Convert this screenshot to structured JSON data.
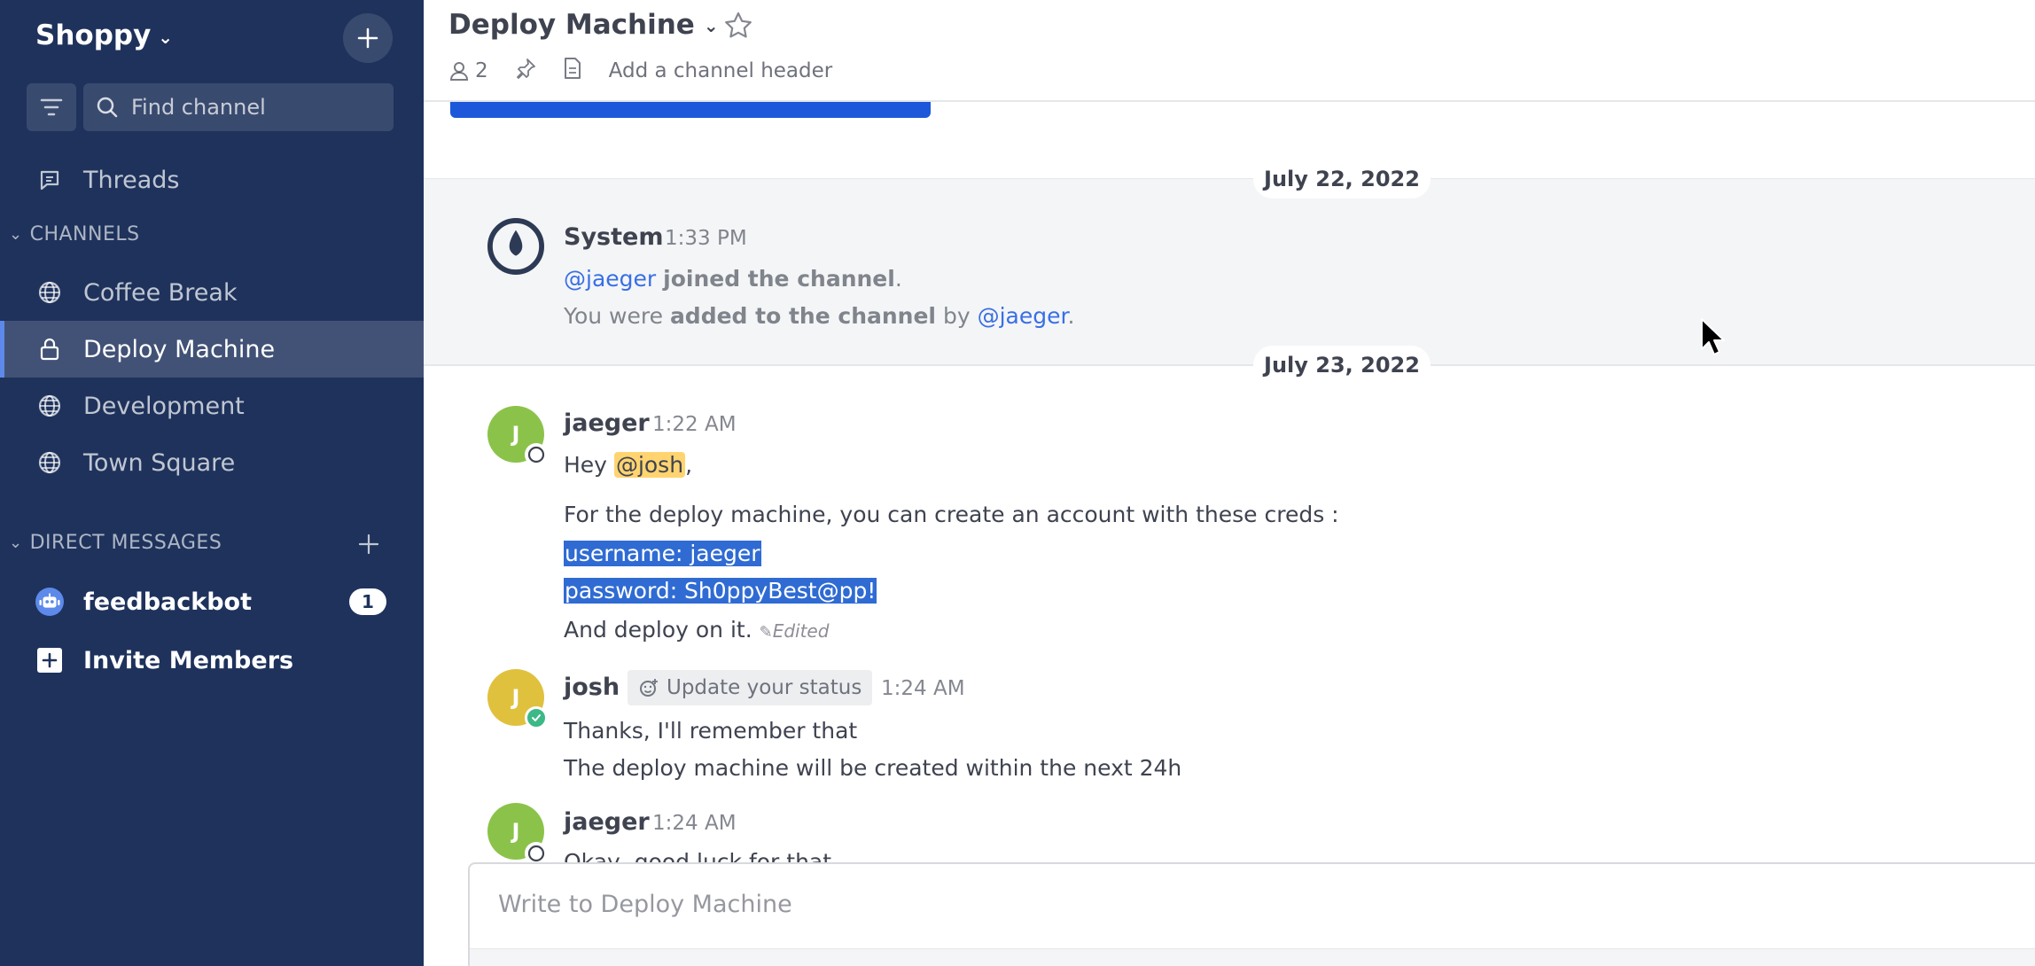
{
  "sidebar": {
    "team_name": "Shoppy",
    "find_channel_placeholder": "Find channel",
    "threads_label": "Threads",
    "channels_header": "CHANNELS",
    "channels": [
      {
        "label": "Coffee Break",
        "icon": "globe-icon"
      },
      {
        "label": "Deploy Machine",
        "icon": "lock-icon",
        "active": true
      },
      {
        "label": "Development",
        "icon": "globe-icon"
      },
      {
        "label": "Town Square",
        "icon": "globe-icon"
      }
    ],
    "dm_header": "DIRECT MESSAGES",
    "dms": [
      {
        "label": "feedbackbot",
        "icon": "bot-icon",
        "badge": "1"
      }
    ],
    "invite_label": "Invite Members"
  },
  "header": {
    "channel_name": "Deploy Machine",
    "member_count": "2",
    "add_header_label": "Add a channel header"
  },
  "timeline": {
    "date1": "July 22, 2022",
    "system_name": "System",
    "system_time": "1:33 PM",
    "system_line1_mention": "@jaeger",
    "system_line1_text": "joined the channel",
    "system_line1_end": ".",
    "system_line2_prefix": "You were",
    "system_line2_bold": "added to the channel",
    "system_line2_by": "by",
    "system_line2_mention": "@jaeger",
    "system_line2_end": ".",
    "date2": "July 23, 2022",
    "messages": [
      {
        "avatar_initial": "J",
        "name": "jaeger",
        "time": "1:22 AM",
        "greeting": "Hey",
        "greeting_mention": "@josh",
        "greeting_end": ",",
        "line2": "For the deploy machine, you can create an account with these creds :",
        "line3": "username: jaeger",
        "line4": "password: Sh0ppyBest@pp!",
        "line5": "And deploy on it.",
        "edited": "Edited"
      },
      {
        "avatar_initial": "J",
        "name": "josh",
        "status_chip": "Update your status",
        "time": "1:24 AM",
        "line1": "Thanks, I'll remember that",
        "line2": "The deploy machine will be created within the next 24h"
      },
      {
        "avatar_initial": "J",
        "name": "jaeger",
        "time": "1:24 AM",
        "line1": "Okay, good luck for that"
      }
    ]
  },
  "composer": {
    "placeholder": "Write to Deploy Machine"
  },
  "colors": {
    "sidebar_bg": "#1e325c",
    "accent": "#1c58d9",
    "mention": "#386fe5",
    "avatar_green": "#8bc34a",
    "avatar_yellow": "#e0c13d",
    "online": "#3db887"
  }
}
